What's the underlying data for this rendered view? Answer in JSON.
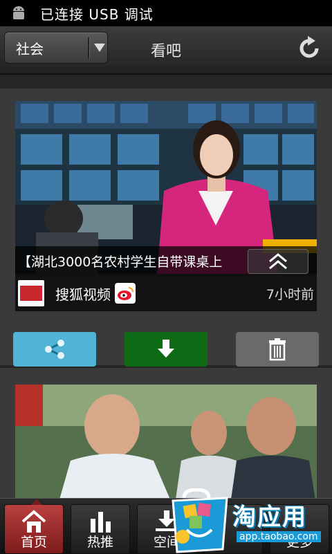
{
  "status_bar": {
    "text": "已连接 USB 调试"
  },
  "header": {
    "category": "社会",
    "title": "看吧"
  },
  "videos": [
    {
      "title": "【湖北3000名农村学生自带课桌上",
      "source": "搜狐视频",
      "time": "7小时前"
    },
    {
      "title": ""
    }
  ],
  "actions": {
    "share": "share-icon",
    "download": "download-icon",
    "delete": "trash-icon"
  },
  "nav": {
    "tabs": [
      {
        "label": "首页"
      },
      {
        "label": "热推"
      },
      {
        "label": "空间"
      },
      {
        "label": ""
      },
      {
        "label": "更多"
      }
    ],
    "active": 0
  },
  "watermark": {
    "title": "淘应用",
    "url": "app.taobao.com"
  },
  "colors": {
    "share": "#4fb4d6",
    "download": "#0e6a15",
    "delete": "#6a6a6a",
    "active_tab": "#9e2e2d"
  }
}
